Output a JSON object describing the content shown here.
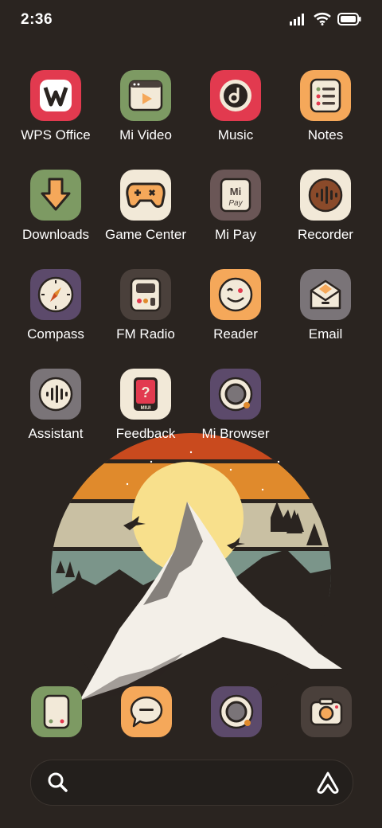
{
  "status_bar": {
    "time": "2:36",
    "icons": [
      "signal-icon",
      "wifi-icon",
      "battery-icon"
    ]
  },
  "apps": [
    {
      "name": "wps-office",
      "label": "WPS Office",
      "bg": "#e23a4f",
      "icon": "wps-logo-icon"
    },
    {
      "name": "mi-video",
      "label": "Mi Video",
      "bg": "#7d9a63",
      "icon": "video-player-icon"
    },
    {
      "name": "music",
      "label": "Music",
      "bg": "#e23a4f",
      "icon": "music-disc-icon"
    },
    {
      "name": "notes",
      "label": "Notes",
      "bg": "#f5a85a",
      "icon": "notes-list-icon"
    },
    {
      "name": "downloads",
      "label": "Downloads",
      "bg": "#7d9a63",
      "icon": "download-arrow-icon"
    },
    {
      "name": "game-center",
      "label": "Game Center",
      "bg": "#f2e9d8",
      "icon": "gamepad-icon"
    },
    {
      "name": "mi-pay",
      "label": "Mi Pay",
      "bg": "#6a5656",
      "icon": "mi-pay-card-icon"
    },
    {
      "name": "recorder",
      "label": "Recorder",
      "bg": "#f2e9d8",
      "icon": "sound-wave-icon"
    },
    {
      "name": "compass",
      "label": "Compass",
      "bg": "#5c4a6b",
      "icon": "compass-icon"
    },
    {
      "name": "fm-radio",
      "label": "FM Radio",
      "bg": "#4a403b",
      "icon": "radio-icon"
    },
    {
      "name": "reader",
      "label": "Reader",
      "bg": "#f5a85a",
      "icon": "smiley-face-icon"
    },
    {
      "name": "email",
      "label": "Email",
      "bg": "#7a7478",
      "icon": "envelope-icon"
    },
    {
      "name": "assistant",
      "label": "Assistant",
      "bg": "#7a7478",
      "icon": "voice-assistant-icon"
    },
    {
      "name": "feedback",
      "label": "Feedback",
      "bg": "#f2e9d8",
      "icon": "feedback-question-icon"
    },
    {
      "name": "mi-browser",
      "label": "Mi Browser",
      "bg": "#5c4a6b",
      "icon": "browser-icon"
    }
  ],
  "dock": [
    {
      "name": "phone",
      "bg": "#7d9a63",
      "icon": "phone-handset-icon"
    },
    {
      "name": "messages",
      "bg": "#f5a85a",
      "icon": "chat-bubble-icon"
    },
    {
      "name": "browser",
      "bg": "#5c4a6b",
      "icon": "browser-icon"
    },
    {
      "name": "camera",
      "bg": "#4a403b",
      "icon": "camera-icon"
    }
  ],
  "search": {
    "icon": "search-icon",
    "right_icon": "assistant-logo-icon"
  },
  "colors": {
    "background": "#2a2420",
    "sunset_red": "#c94a1e",
    "sunset_orange": "#e08a2c",
    "sun": "#f8e08c",
    "sky_beige": "#c9c0a3",
    "sky_teal": "#7b958a"
  }
}
